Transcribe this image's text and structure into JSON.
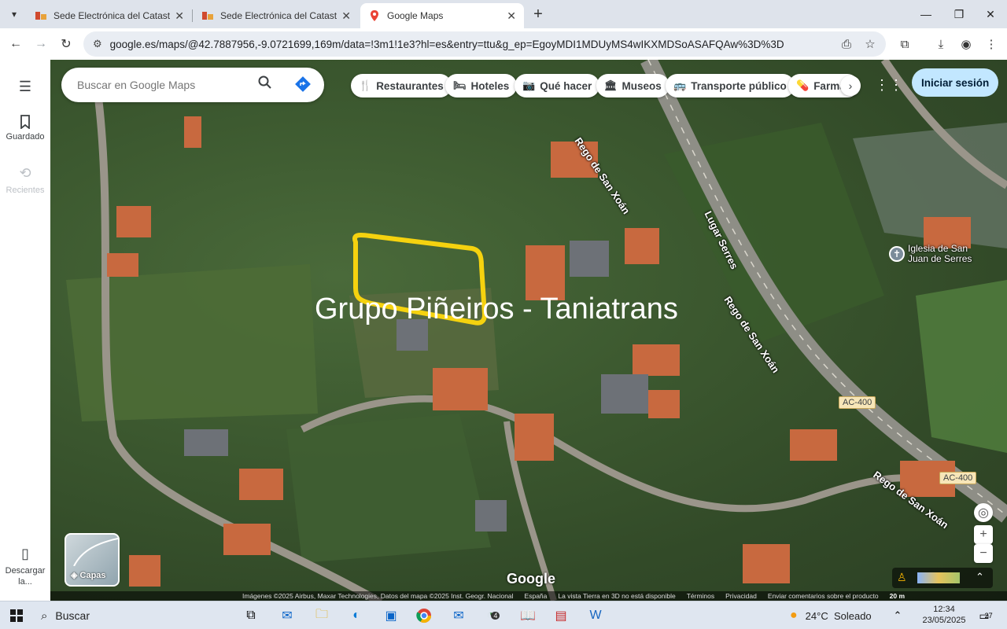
{
  "browser": {
    "tabs": [
      {
        "title": "Sede Electrónica del Catastro - ",
        "active": false
      },
      {
        "title": "Sede Electrónica del Catastro - ",
        "active": false
      },
      {
        "title": "Google Maps",
        "active": true
      }
    ],
    "url": "google.es/maps/@42.7887956,-9.0721699,169m/data=!3m1!1e3?hl=es&entry=ttu&g_ep=EgoyMDI1MDUyMS4wIKXMDSoASAFQAw%3D%3D"
  },
  "rail": {
    "saved_label": "Guardado",
    "recent_label": "Recientes",
    "download_label": "Descargar la..."
  },
  "search": {
    "placeholder": "Buscar en Google Maps"
  },
  "chips": [
    {
      "label": "Restaurantes",
      "icon": "fork-knife-icon"
    },
    {
      "label": "Hoteles",
      "icon": "bed-icon"
    },
    {
      "label": "Qué hacer",
      "icon": "camera-icon"
    },
    {
      "label": "Museos",
      "icon": "museum-icon"
    },
    {
      "label": "Transporte público",
      "icon": "bus-icon"
    },
    {
      "label": "Farmac",
      "icon": "pharmacy-icon"
    }
  ],
  "signin_label": "Iniciar sesión",
  "overlay_text": "Grupo Piñeiros - Taniatrans",
  "map_labels": {
    "street1": "Rego de San Xoán",
    "street2": "Lugar Serres",
    "street3": "Rego de San Xoán",
    "street4": "Rego de San Xoán",
    "poi": "Iglesia de San Juan de Serres",
    "road1": "AC-400",
    "road2": "AC-400"
  },
  "layers_label": "Capas",
  "google_logo": "Google",
  "footer": {
    "imagery": "Imágenes ©2025 Airbus, Maxar Technologies, Datos del mapa ©2025 Inst. Geogr. Nacional",
    "country": "España",
    "earth_note": "La vista Tierra en 3D no está disponible",
    "terms": "Términos",
    "privacy": "Privacidad",
    "feedback": "Enviar comentarios sobre el producto",
    "scale": "20 m"
  },
  "taskbar": {
    "search_label": "Buscar",
    "weather": "24°C  Soleado",
    "time": "12:34",
    "date": "23/05/2025",
    "notif_count": "27",
    "app_badge": "4"
  },
  "colors": {
    "highlight": "#f5d20f",
    "signin_bg": "#c2e7ff"
  }
}
